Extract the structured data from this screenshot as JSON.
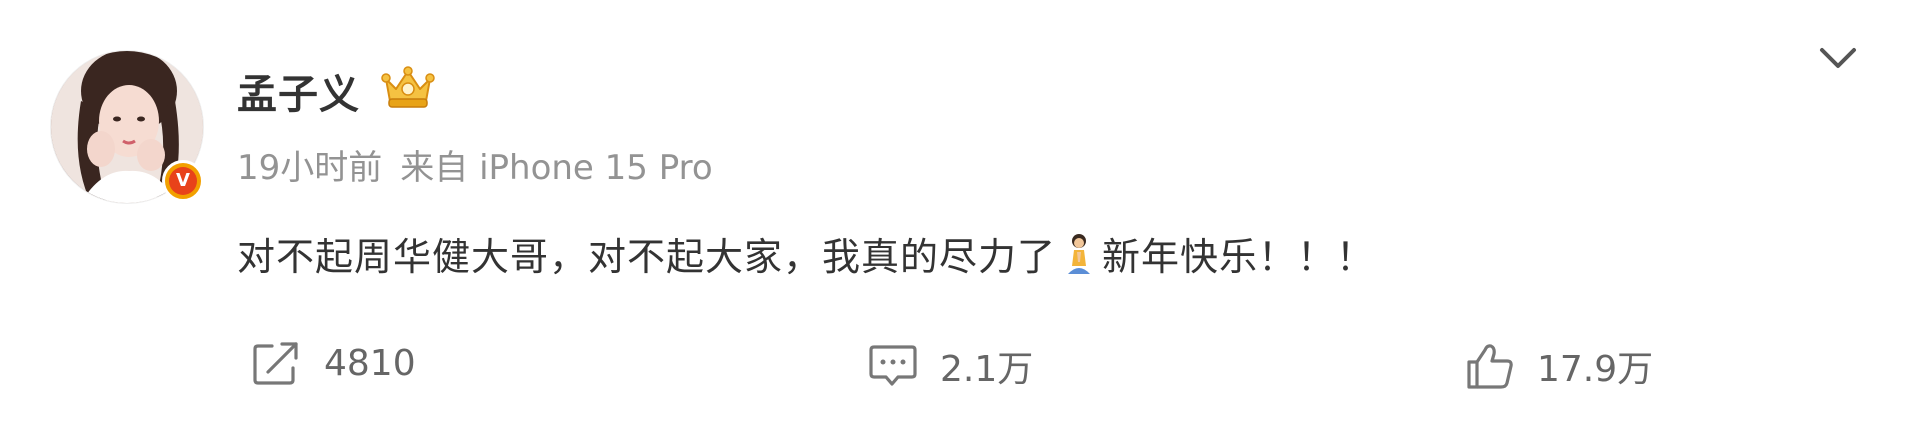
{
  "post": {
    "username": "孟子义",
    "time": "19小时前",
    "source": "来自 iPhone 15 Pro",
    "text_part1": "对不起周华健大哥，对不起大家，我真的尽力了",
    "text_part2": "新年快乐！！！"
  },
  "actions": {
    "repost_count": "4810",
    "comment_count": "2.1万",
    "like_count": "17.9万"
  },
  "badges": {
    "verified_label": "V"
  },
  "icons": {
    "avatar": "user-avatar-photo",
    "verified": "verified-badge-icon",
    "crown": "vip-crown-icon",
    "more": "chevron-down-icon",
    "emoji": "praying-person-emoji",
    "repost": "repost-icon",
    "comment": "comment-icon",
    "like": "like-thumb-icon"
  },
  "colors": {
    "text": "#333333",
    "meta": "#939393",
    "action_text": "#666666",
    "verified_orange": "#f2a000",
    "verified_red": "#e8421a",
    "crown_gold": "#e8a317"
  }
}
